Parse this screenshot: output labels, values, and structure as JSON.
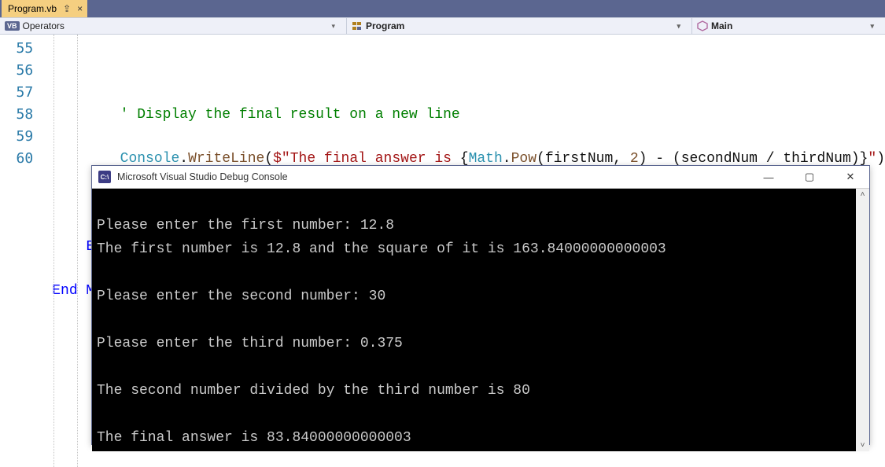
{
  "tab": {
    "filename": "Program.vb",
    "pin_glyph": "⇪",
    "close_glyph": "×"
  },
  "crumbs": {
    "seg1": "Operators",
    "seg2": "Program",
    "seg3": "Main",
    "vb_badge": "VB",
    "drop_glyph": "▾"
  },
  "gutter": [
    "55",
    "56",
    "57",
    "58",
    "59",
    "60"
  ],
  "code": {
    "l55_comment": "' Display the final result on a new line",
    "l56_Console": "Console",
    "l56_dot": ".",
    "l56_WriteLine": "WriteLine",
    "l56_open": "(",
    "l56_dollar": "$",
    "l56_str1": "\"The final answer is ",
    "l56_lbrace": "{",
    "l56_Math": "Math",
    "l56_dot2": ".",
    "l56_Pow": "Pow",
    "l56_open2": "(",
    "l56_first": "firstNum",
    "l56_comma": ", ",
    "l56_two": "2",
    "l56_close2": ")",
    "l56_minus": " - (",
    "l56_second": "secondNum",
    "l56_slash": " / ",
    "l56_third": "thirdNum",
    "l56_close3": ")",
    "l56_rbrace": "}",
    "l56_str2": "\"",
    "l56_close": ")",
    "l58": "End Sub",
    "l59": "End Module"
  },
  "console": {
    "title": "Microsoft Visual Studio Debug Console",
    "icon_text": "C:\\",
    "lines": [
      "Please enter the first number: 12.8",
      "The first number is 12.8 and the square of it is 163.84000000000003",
      "",
      "Please enter the second number: 30",
      "",
      "Please enter the third number: 0.375",
      "",
      "The second number divided by the third number is 80",
      "",
      "The final answer is 83.84000000000003"
    ],
    "min": "—",
    "max": "▢",
    "close": "✕",
    "scroll_up": "˄",
    "scroll_down": "˅"
  }
}
